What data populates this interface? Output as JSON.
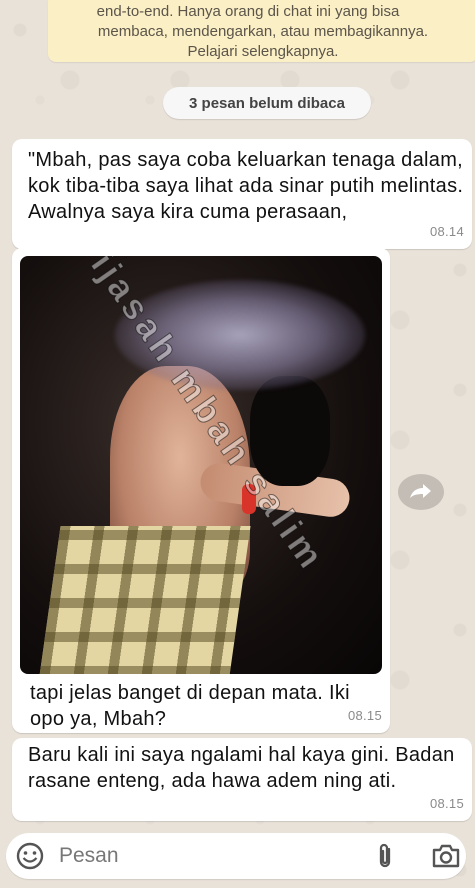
{
  "encryption_notice": {
    "line1": "end-to-end. Hanya orang di chat ini yang bisa",
    "line2": "membaca, mendengarkan, atau membagikannya.",
    "line3": "Pelajari selengkapnya."
  },
  "unread_divider": "3 pesan belum dibaca",
  "messages": [
    {
      "text": "\"Mbah, pas saya coba keluarkan tenaga dalam, kok tiba-tiba saya lihat ada sinar putih melintas. Awalnya saya kira cuma perasaan,",
      "time": "08.14"
    },
    {
      "image_watermark": "ijasah mbah salim",
      "text": "tapi jelas banget di depan mata. Iki opo ya, Mbah?",
      "time": "08.15"
    },
    {
      "text": "Baru kali ini saya ngalami hal kaya gini. Badan rasane enteng, ada hawa adem ning ati.",
      "time": "08.15"
    }
  ],
  "composer": {
    "placeholder": "Pesan"
  },
  "icons": {
    "emoji": "emoji-icon",
    "attach": "paperclip-icon",
    "camera": "camera-icon",
    "forward": "forward-icon"
  }
}
